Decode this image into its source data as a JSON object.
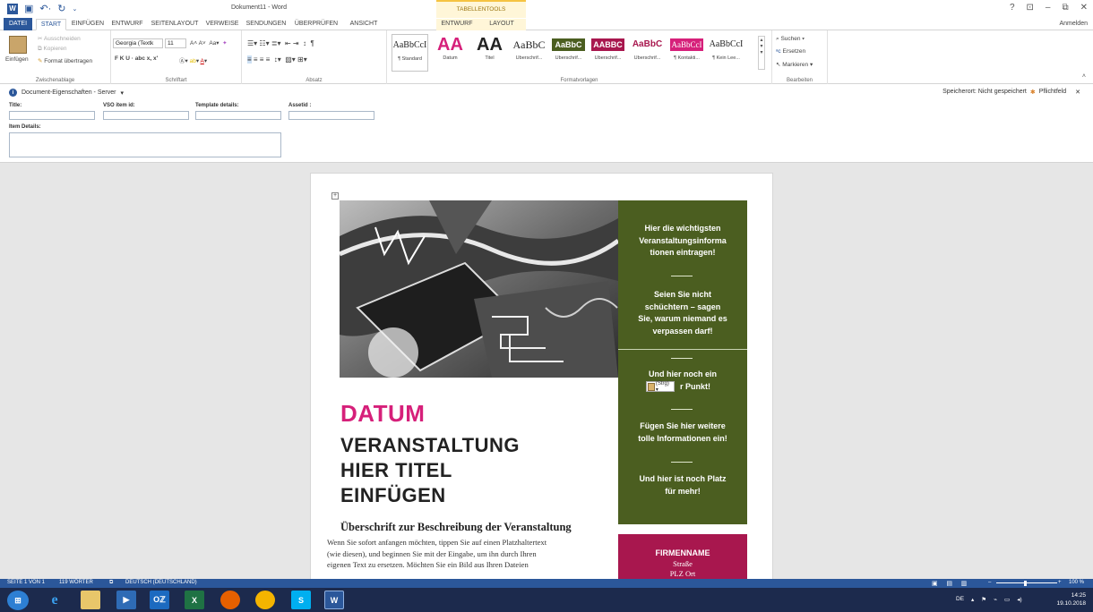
{
  "app": {
    "doc_title": "Dokument11 - Word",
    "context_group": "TABELLENTOOLS",
    "signin": "Anmelden",
    "window_controls": [
      "?",
      "⊡",
      "–",
      "⧉",
      "✕"
    ]
  },
  "tabs": [
    "DATEI",
    "START",
    "EINFÜGEN",
    "ENTWURF",
    "SEITENLAYOUT",
    "VERWEISE",
    "SENDUNGEN",
    "ÜBERPRÜFEN",
    "ANSICHT",
    "ENTWURF",
    "LAYOUT"
  ],
  "ribbon": {
    "clipboard": {
      "paste": "Einfügen",
      "cut": "Ausschneiden",
      "copy": "Kopieren",
      "format": "Format übertragen",
      "label": "Zwischenablage"
    },
    "font": {
      "name": "Georgia (Textk",
      "size": "11",
      "row2": "F  K  U  ·  abc  x,  x'",
      "label": "Schriftart"
    },
    "paragraph": {
      "label": "Absatz"
    },
    "styles": {
      "items": [
        {
          "preview": "AaBbCcI",
          "label": "¶ Standard"
        },
        {
          "preview": "AA",
          "label": "Datum"
        },
        {
          "preview": "AA",
          "label": "Titel"
        },
        {
          "preview": "AaBbC",
          "label": "Überschrif..."
        },
        {
          "preview": "AaBbC",
          "label": "Überschrif..."
        },
        {
          "preview": "AABBC",
          "label": "Überschrif..."
        },
        {
          "preview": "AaBbC",
          "label": "Überschrif..."
        },
        {
          "preview": "AaBbCcI",
          "label": "¶ Kontakti..."
        },
        {
          "preview": "AaBbCcI",
          "label": "¶ Kein Lee..."
        }
      ],
      "label": "Formatvorlagen"
    },
    "editing": {
      "find": "Suchen",
      "replace": "Ersetzen",
      "select": "Markieren",
      "label": "Bearbeiten"
    }
  },
  "properties": {
    "header": "Document-Eigenschaften - Server",
    "save_location": "Speicherort: Nicht gespeichert",
    "required": "Pflichtfeld",
    "fields": {
      "title": "Title:",
      "vso": "VSO item id:",
      "template": "Template details:",
      "assetid": "Assetid :",
      "item_details": "Item Details:"
    }
  },
  "document": {
    "datum": "DATUM",
    "title_lines": [
      "VERANSTALTUNG",
      "HIER TITEL",
      "EINFÜGEN"
    ],
    "subhead": "Überschrift zur Beschreibung der Veranstaltung",
    "body_lines": [
      "Wenn Sie sofort anfangen möchten, tippen Sie auf einen Platzhaltertext",
      "(wie diesen), und beginnen Sie mit der Eingabe, um ihn durch Ihren",
      "eigenen Text zu ersetzen. Möchten Sie ein Bild aus Ihren Dateien"
    ],
    "sidebar": {
      "block1": [
        "Hier die wichtigsten",
        "Veranstaltungsinforma",
        "tionen eintragen!"
      ],
      "block2": [
        "Seien Sie nicht",
        "schüchtern – sagen",
        "Sie, warum niemand es",
        "verpassen darf!"
      ],
      "block3": [
        "Und hier noch ein",
        "r Punkt!"
      ],
      "block4": [
        "Fügen Sie hier weitere",
        "tolle Informationen ein!"
      ],
      "block5": [
        "Und hier ist noch Platz",
        "für mehr!"
      ]
    },
    "paste_tag": "(Strg) ▾",
    "company": {
      "name": "FIRMENNAME",
      "street": "Straße",
      "city": "PLZ Ort"
    }
  },
  "statusbar": {
    "page": "SEITE 1 VON 1",
    "words": "119 WÖRTER",
    "language": "DEUTSCH (DEUTSCHLAND)",
    "zoom": "100 %"
  },
  "taskbar": {
    "lang": "DE",
    "time": "14:25",
    "date": "19.10.2018",
    "apps": [
      "start",
      "ie",
      "explorer",
      "media",
      "outlook",
      "excel",
      "firefox",
      "chrome",
      "skype",
      "word"
    ]
  }
}
